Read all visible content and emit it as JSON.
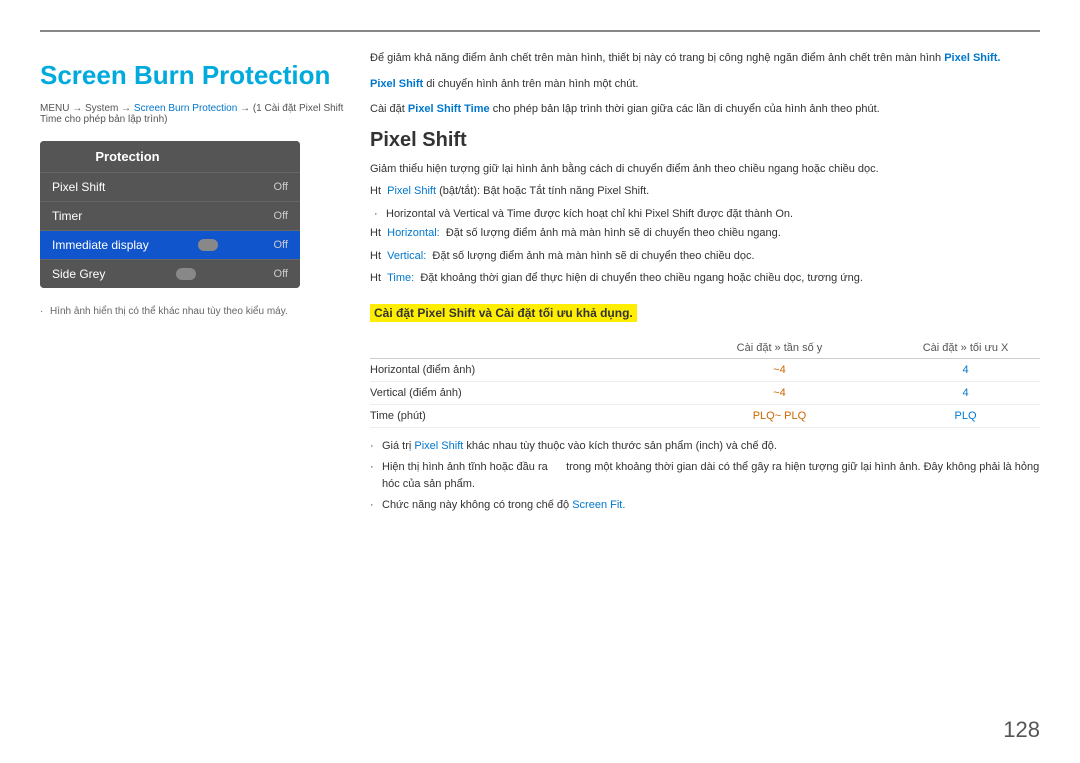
{
  "top_line": true,
  "left": {
    "title": "Screen Burn Protection",
    "breadcrumb": "MENU → System → Screen Burn Protection → (1 Cài đặt Pixel Shift Time cho phép bản lập trình)",
    "breadcrumb_highlight": "Screen Burn Protection",
    "menu_header": "Protection",
    "menu_items": [
      {
        "label": "Pixel Shift",
        "value": "Off",
        "state": "normal"
      },
      {
        "label": "Timer",
        "value": "Off",
        "state": "normal"
      },
      {
        "label": "Immediate display",
        "value": "Off",
        "state": "highlighted"
      },
      {
        "label": "Side Grey",
        "value": "Off",
        "state": "normal"
      }
    ],
    "footnote": "Hình ảnh hiển thị có thể khác nhau tùy theo kiểu máy."
  },
  "right": {
    "intro1": "Để giảm khả năng điểm ảnh chết trên màn hình, thiết bị này có trang bị công nghệ ngăn điểm ảnh chết trên màn hình",
    "intro1_highlight": "Pixel Shift.",
    "intro2_pre": "Pixel Shift",
    "intro2": "di chuyển hình ảnh trên màn hình một chút.",
    "intro3_pre": "Cài đặt",
    "intro3_highlight": "Pixel Shift Time",
    "intro3": "cho phép bản lập trình thời gian giữa các lần di chuyển của hình ảnh theo phút.",
    "section_title": "Pixel Shift",
    "desc": "Giảm thiểu hiện tượng giữ lại hình ảnh bằng cách di chuyển điểm ảnh theo chiều ngang hoặc chiều dọc.",
    "ht1_pre": "Ht",
    "ht1_blue": "Pixel Shift",
    "ht1_rest": "(bật/tắt):",
    "ht1_detail": "Bật hoặc Tắt tính năng Pixel Shift.",
    "ht1_sub": "· Horizontal và Vertical và Time được kích hoạt chỉ khi Pixel Shift được đặt thành On.",
    "ht2_pre": "Ht",
    "ht2_blue": "Horizontal:",
    "ht2_rest": "Đặt số lượng điểm ảnh mà màn hình sẽ di chuyển theo chiều ngang.",
    "ht3_pre": "Ht",
    "ht3_blue": "Vertical:",
    "ht3_rest": "Đặt số lượng điểm ảnh mà màn hình sẽ di chuyển theo chiều dọc.",
    "ht4_pre": "Ht",
    "ht4_blue": "Time:",
    "ht4_rest": "Đặt khoảng thời gian để thực hiện di chuyển theo chiều ngang hoặc chiều dọc, tương ứng.",
    "highlight_box": "Cài đặt Pixel Shift và Cài đặt tối ưu khả dụng.",
    "table": {
      "col1": "Cài đặt » tần số y",
      "col2": "Cài đặt » tối ưu X",
      "rows": [
        {
          "label": "Horizontal (điểm ảnh)",
          "val1": "~4",
          "val2": "4"
        },
        {
          "label": "Vertical (điểm ảnh)",
          "val1": "~4",
          "val2": "4"
        },
        {
          "label": "Time (phút)",
          "val1": "PLQ~   PLQ",
          "val2": "PLQ"
        }
      ]
    },
    "bullets": [
      "Giá trị Pixel Shift khác nhau tùy thuộc vào kích thước sản phẩm (inch) và chế độ.",
      "Hiện thị hình ảnh tĩnh hoặc đầu ra     trong một khoảng thời gian dài có thể gây ra hiện tượng giữ lại hình ảnh. Đây không phải là hỏng hóc của sản phẩm.",
      "Chức năng này không có trong chế độ Screen Fit."
    ]
  },
  "page_number": "128"
}
